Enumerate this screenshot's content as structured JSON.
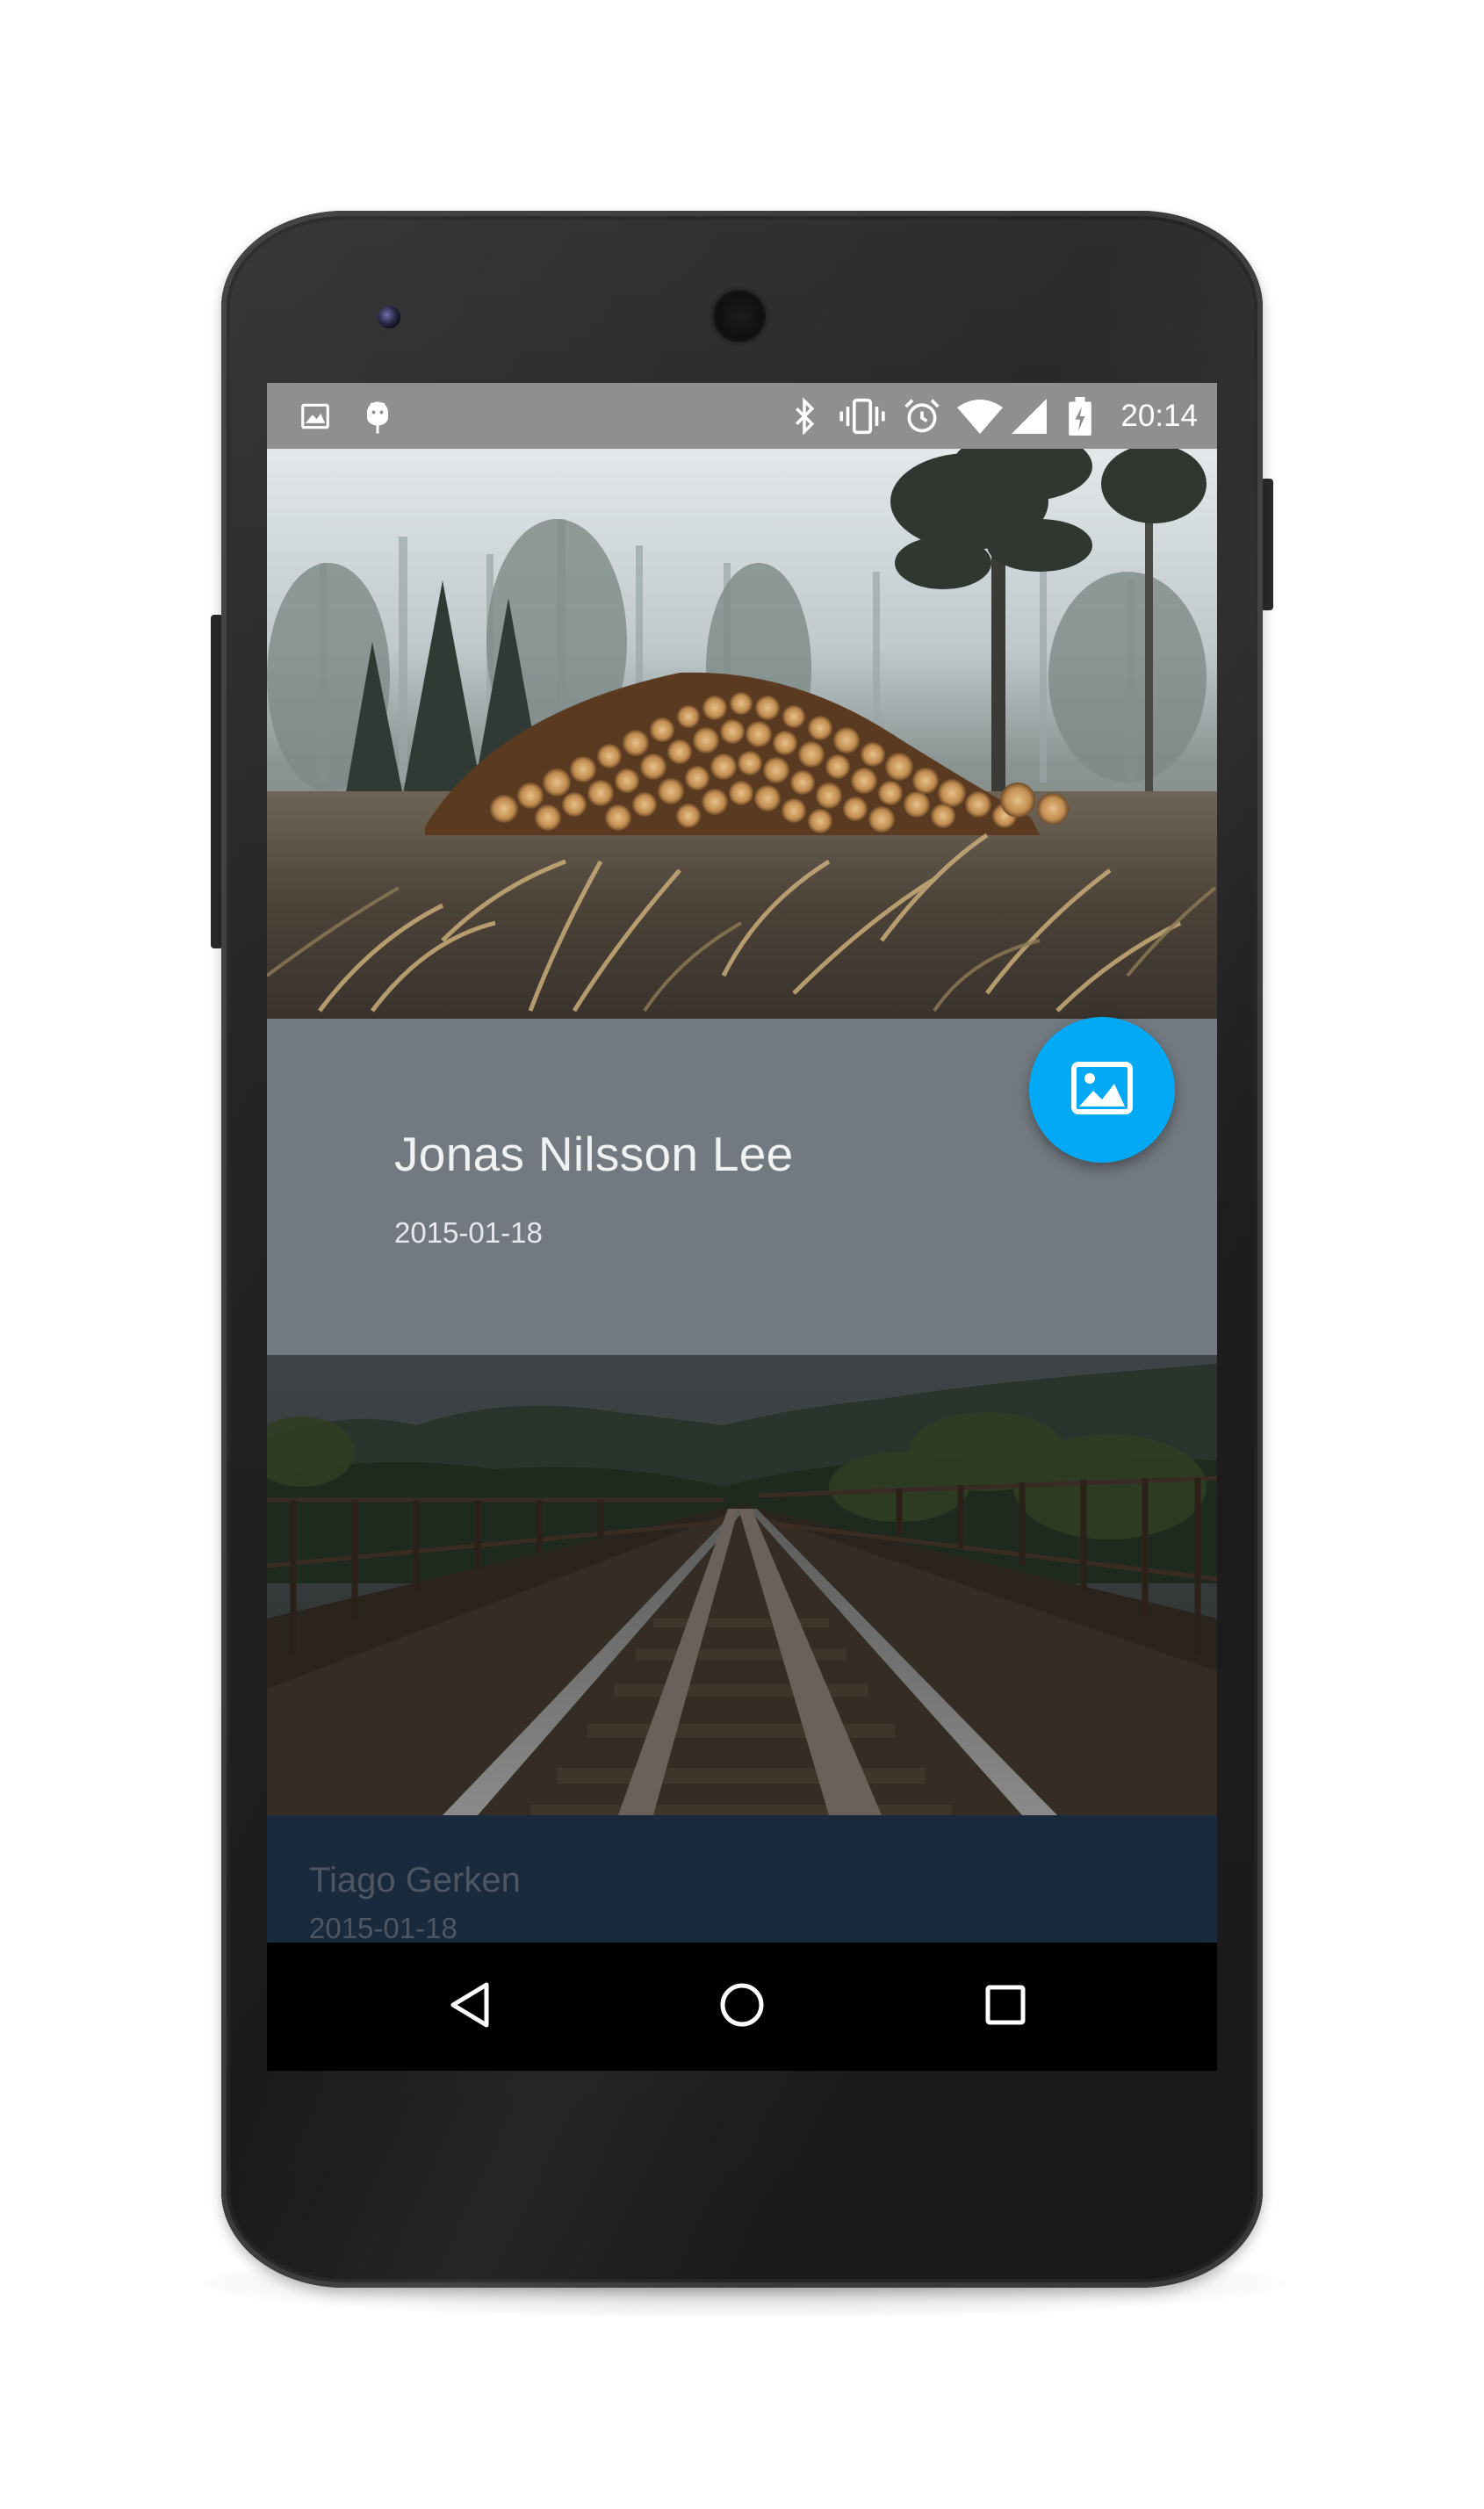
{
  "status_bar": {
    "time": "20:14",
    "left_icons": [
      "image-notification-icon",
      "android-debug-icon"
    ],
    "right_icons": [
      "bluetooth-icon",
      "vibrate-icon",
      "alarm-icon",
      "wifi-icon",
      "cellular-signal-icon",
      "battery-charging-icon"
    ]
  },
  "cards": [
    {
      "name": "Jonas Nilsson Lee",
      "date": "2015-01-18",
      "image": "forest-log-pile-photo",
      "info_color": "#727980"
    },
    {
      "name": "Tiago Gerken",
      "date": "2015-01-18",
      "image": "railway-bridge-photo",
      "info_color": "#182a3b"
    }
  ],
  "fab": {
    "icon": "image-icon",
    "color": "#03a9f4"
  },
  "nav_bar": {
    "buttons": [
      "back-icon",
      "home-icon",
      "recents-icon"
    ]
  }
}
